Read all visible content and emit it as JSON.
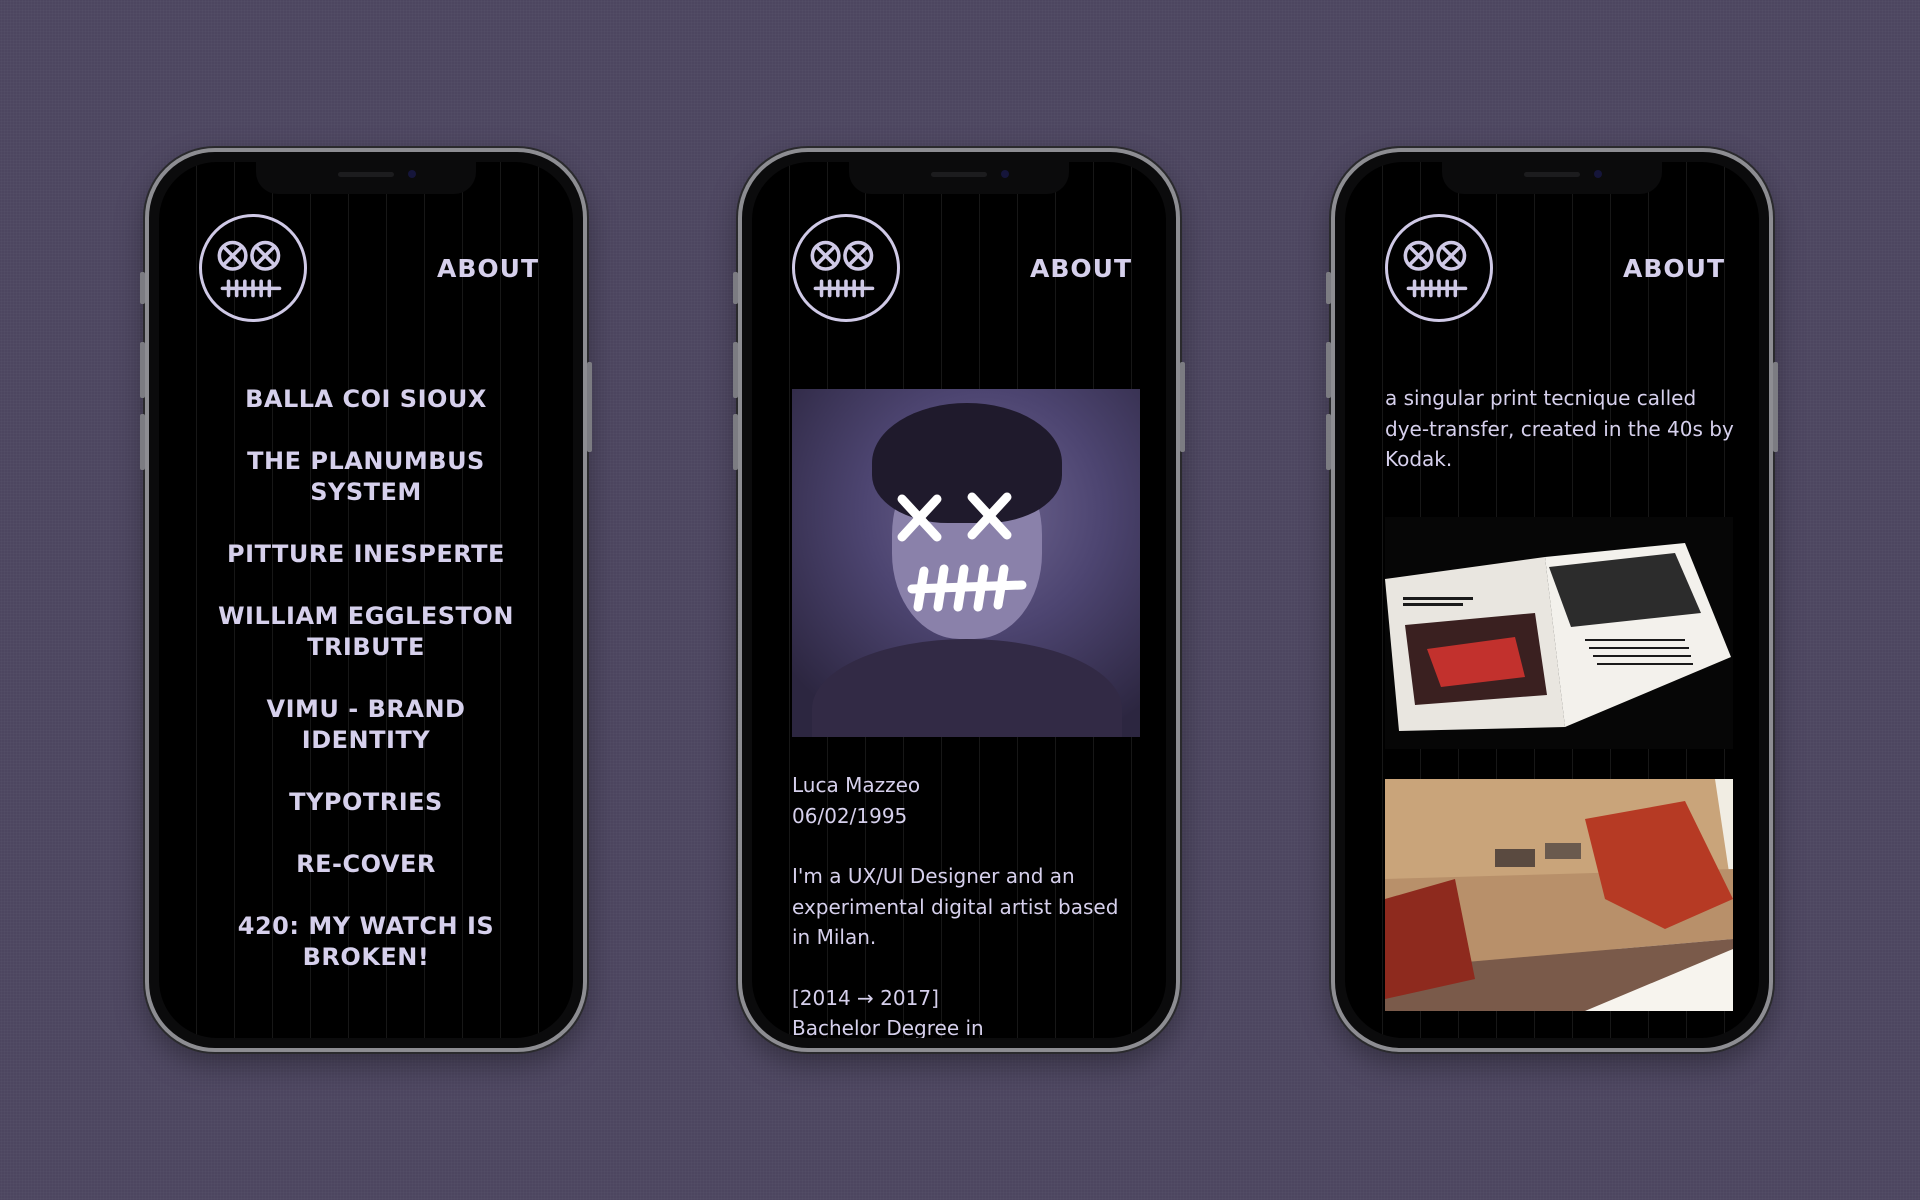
{
  "header": {
    "about_label": "ABOUT"
  },
  "phone1": {
    "menu": [
      "BALLA COI SIOUX",
      "THE PLANUMBUS SYSTEM",
      "PITTURE INESPERTE",
      "WILLIAM EGGLESTON TRIBUTE",
      "VIMU - BRAND IDENTITY",
      "TYPOTRIES",
      "RE-COVER",
      "420: MY WATCH IS BROKEN!"
    ]
  },
  "phone2": {
    "name": "Luca Mazzeo",
    "dob": "06/02/1995",
    "intro": "I'm a UX/UI Designer and an experimental digital artist based in Milan.",
    "edu_years": "[2014 → 2017]",
    "edu_degree": "Bachelor Degree in"
  },
  "phone3": {
    "paragraph": "a singular print tecnique called dye-transfer, created in the 40s by Kodak."
  },
  "colors": {
    "background": "#4d4660",
    "accent": "#d6d0ec",
    "screen": "#000000"
  },
  "icons": [
    "x-eyes-logo-icon"
  ]
}
